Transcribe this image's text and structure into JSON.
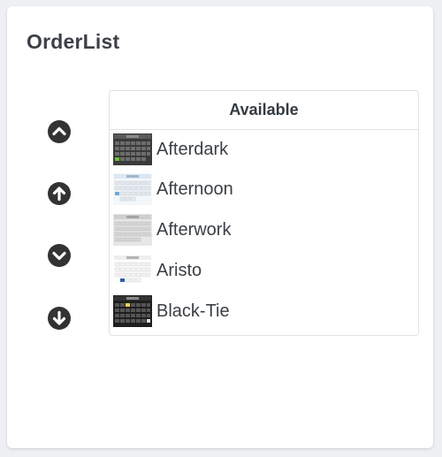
{
  "title": "OrderList",
  "controls": [
    {
      "name": "move-top-button",
      "icon": "chevron-circle-up-icon"
    },
    {
      "name": "move-up-button",
      "icon": "arrow-circle-up-icon"
    },
    {
      "name": "move-down-button",
      "icon": "chevron-circle-down-icon"
    },
    {
      "name": "move-bottom-button",
      "icon": "arrow-circle-down-icon"
    }
  ],
  "list": {
    "header": "Available",
    "items": [
      {
        "label": "Afterdark",
        "thumb": "afterdark-theme-thumbnail"
      },
      {
        "label": "Afternoon",
        "thumb": "afternoon-theme-thumbnail"
      },
      {
        "label": "Afterwork",
        "thumb": "afterwork-theme-thumbnail"
      },
      {
        "label": "Aristo",
        "thumb": "aristo-theme-thumbnail"
      },
      {
        "label": "Black-Tie",
        "thumb": "black-tie-theme-thumbnail"
      }
    ]
  },
  "colors": {
    "icon": "#333333",
    "border": "#dee2e6",
    "background": "#eef0f3"
  }
}
